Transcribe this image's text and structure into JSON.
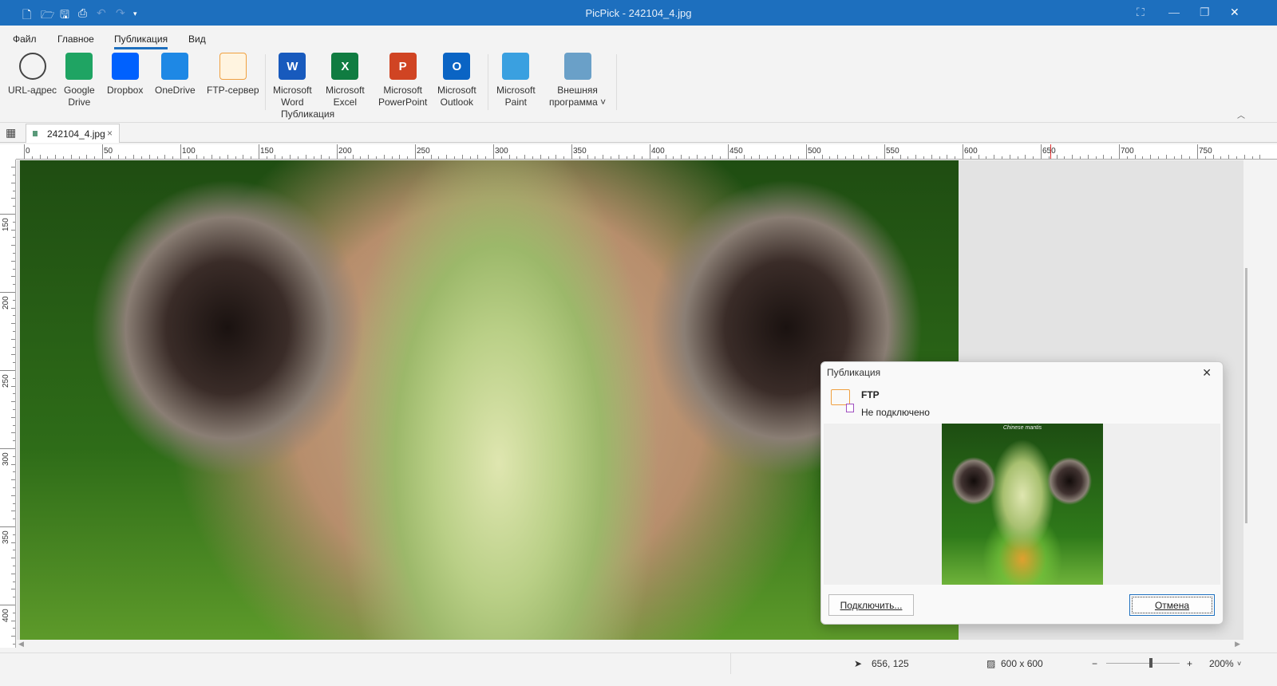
{
  "app": {
    "title": "PicPick - 242104_4.jpg"
  },
  "menu": [
    "Файл",
    "Главное",
    "Публикация",
    "Вид"
  ],
  "ribbon": {
    "items": [
      {
        "l1": "URL-адрес",
        "l2": "",
        "icon": "globe-link-icon",
        "color": "#555555"
      },
      {
        "l1": "Google",
        "l2": "Drive",
        "icon": "google-drive-icon",
        "color": "#1fa463"
      },
      {
        "l1": "Dropbox",
        "l2": "",
        "icon": "dropbox-icon",
        "color": "#0061fe"
      },
      {
        "l1": "OneDrive",
        "l2": "",
        "icon": "onedrive-icon",
        "color": "#1e88e5"
      },
      {
        "l1": "FTP-сервер",
        "l2": "",
        "icon": "ftp-folder-icon",
        "color": "#f0a040"
      },
      {
        "l1": "Microsoft",
        "l2": "Word",
        "icon": "word-icon",
        "color": "#185abd",
        "glyph": "W"
      },
      {
        "l1": "Microsoft",
        "l2": "Excel",
        "icon": "excel-icon",
        "color": "#107c41",
        "glyph": "X"
      },
      {
        "l1": "Microsoft",
        "l2": "PowerPoint",
        "icon": "powerpoint-icon",
        "color": "#d04423",
        "glyph": "P"
      },
      {
        "l1": "Microsoft",
        "l2": "Outlook",
        "icon": "outlook-icon",
        "color": "#0a64c4",
        "glyph": "O"
      },
      {
        "l1": "Microsoft",
        "l2": "Paint",
        "icon": "paint-icon",
        "color": "#3aa0e0"
      },
      {
        "l1": "Внешняя",
        "l2": "программа ˅",
        "icon": "external-program-icon",
        "color": "#6aa0c8"
      }
    ],
    "group_label": "Публикация"
  },
  "tab": {
    "name": "242104_4.jpg",
    "close": "×"
  },
  "ruler": {
    "h_labels": [
      "0",
      "50",
      "100",
      "150",
      "200",
      "250",
      "300",
      "350",
      "400",
      "450",
      "500",
      "550",
      "600",
      "650",
      "700",
      "750"
    ],
    "v_labels": [
      "150",
      "200",
      "250",
      "300",
      "350",
      "400"
    ]
  },
  "dialog": {
    "title": "Публикация",
    "close": "✕",
    "service": "FTP",
    "status": "Не подключено",
    "thumb_caption": "Chinese mantis",
    "connect": "Подключить...",
    "cancel": "Отмена"
  },
  "status": {
    "cursor": "656, 125",
    "size": "600 x 600",
    "zoom": "200%",
    "minus": "−",
    "plus": "+"
  }
}
